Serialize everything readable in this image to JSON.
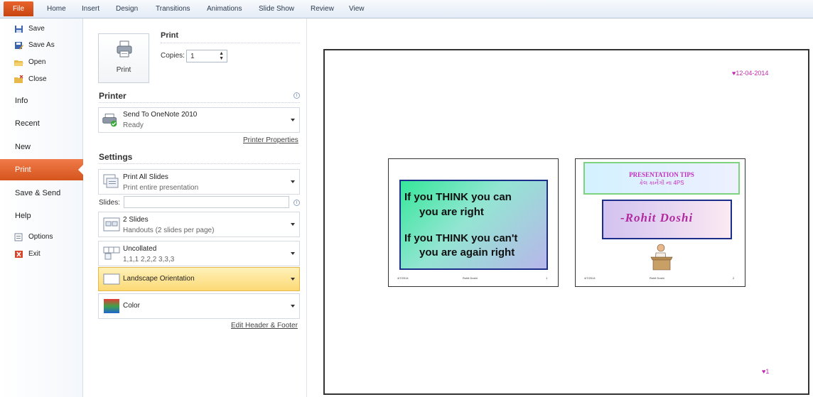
{
  "ribbon": {
    "file": "File",
    "tabs": [
      "Home",
      "Insert",
      "Design",
      "Transitions",
      "Animations",
      "Slide Show",
      "Review",
      "View"
    ]
  },
  "nav": {
    "save": "Save",
    "save_as": "Save As",
    "open": "Open",
    "close": "Close",
    "info": "Info",
    "recent": "Recent",
    "new": "New",
    "print": "Print",
    "save_send": "Save & Send",
    "help": "Help",
    "options": "Options",
    "exit": "Exit"
  },
  "print_panel": {
    "title": "Print",
    "button_label": "Print",
    "copies_label": "Copies:",
    "copies_value": "1",
    "printer_header": "Printer",
    "printer_name": "Send To OneNote 2010",
    "printer_status": "Ready",
    "printer_properties": "Printer Properties",
    "settings_header": "Settings",
    "print_what": "Print All Slides",
    "print_what_sub": "Print entire presentation",
    "slides_label": "Slides:",
    "slides_value": "",
    "layout": "2 Slides",
    "layout_sub": "Handouts (2 slides per page)",
    "collation": "Uncollated",
    "collation_sub": "1,1,1   2,2,2   3,3,3",
    "orientation": "Landscape Orientation",
    "color": "Color",
    "edit_header_footer": "Edit Header & Footer"
  },
  "preview": {
    "date": "♥12-04-2014",
    "page_number": "♥1",
    "slide1": {
      "line1": "If you THINK you can",
      "line2": "you are right",
      "line3": "If you THINK you can't",
      "line4": "you are again right",
      "footer_left": "4/7/2014",
      "footer_mid": "Rohit   Doshi",
      "footer_right": "1"
    },
    "slide2": {
      "title": "PRESENTATION TIPS",
      "subtitle": "કેલ કાર્નેગી ના   4PS",
      "name": "-Rohit  Doshi",
      "footer_left": "4/7/2014",
      "footer_mid": "Rohit   Doshi",
      "footer_right": "2"
    }
  },
  "colors": {
    "file_tab": "#d5541c",
    "active_nav": "#e8632c",
    "orientation_highlight": "#fde48a",
    "accent_pink": "#c028b0"
  }
}
